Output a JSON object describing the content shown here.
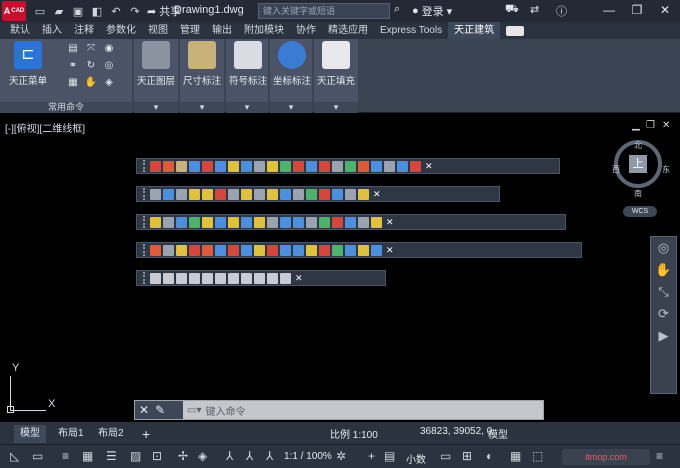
{
  "titlebar": {
    "app_badge": "A",
    "app_badge_sub": "CAD",
    "share": "共享",
    "doc_title": "Drawing1.dwg",
    "search_placeholder": "键入关键字或短语",
    "login": "登录",
    "icons": [
      "new-file-icon",
      "open-icon",
      "save-icon",
      "save-as-icon",
      "undo-icon",
      "redo-icon",
      "share-icon",
      "search-icon",
      "user-icon",
      "cart-icon",
      "help-icon"
    ]
  },
  "tabs": [
    "默认",
    "插入",
    "注释",
    "参数化",
    "视图",
    "管理",
    "输出",
    "附加模块",
    "协作",
    "精选应用",
    "Express Tools",
    "天正建筑"
  ],
  "active_tab": "天正建筑",
  "ribbon": {
    "panel1_big": "天正菜单",
    "panel1_foot": "常用命令",
    "buttons": [
      "天正图层",
      "尺寸标注",
      "符号标注",
      "坐标标注",
      "天正填充"
    ]
  },
  "viewport": {
    "label": "[-][俯视][二维线框]",
    "compass_center": "上",
    "compass_n": "北",
    "compass_s": "南",
    "compass_e": "东",
    "compass_w": "西",
    "wcs": "WCS",
    "ucs_x": "X",
    "ucs_y": "Y"
  },
  "cmdline": {
    "placeholder": "键入命令"
  },
  "layout": {
    "tabs": [
      "模型",
      "布局1",
      "布局2"
    ],
    "add": "+",
    "scale": "比例 1:100",
    "coords": "36823, 39052, 0",
    "model": "模型"
  },
  "status": {
    "scale_label": "1:1 / 100%",
    "text_size": "小数",
    "watermark": "itmop.com"
  }
}
